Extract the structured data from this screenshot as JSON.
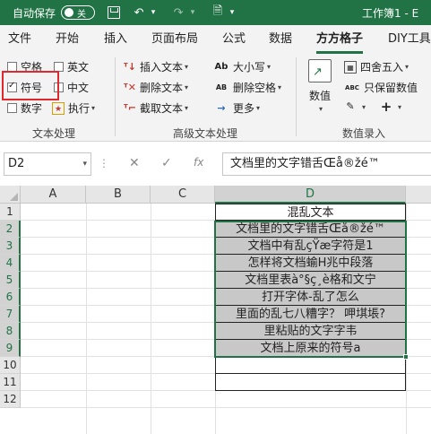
{
  "titlebar": {
    "autosave_label": "自动保存",
    "autosave_state": "关",
    "title": "工作簿1 - E"
  },
  "tabs": [
    "文件",
    "开始",
    "插入",
    "页面布局",
    "公式",
    "数据",
    "方方格子",
    "DIY工具"
  ],
  "active_tab": "方方格子",
  "ribbon": {
    "text_processing": {
      "label": "文本处理",
      "checkboxes": [
        {
          "label": "空格",
          "checked": false
        },
        {
          "label": "英文",
          "checked": false
        },
        {
          "label": "符号",
          "checked": true
        },
        {
          "label": "中文",
          "checked": false
        },
        {
          "label": "数字",
          "checked": false
        }
      ],
      "execute_label": "执行"
    },
    "advanced": {
      "label": "高级文本处理",
      "insert_text": "插入文本",
      "delete_text": "删除文本",
      "extract_text": "截取文本",
      "case_label": "大小写",
      "delete_space": "删除空格",
      "more": "更多",
      "case_icon": "Ab",
      "delete_space_icon": "AB"
    },
    "numbers": {
      "label": "数值录入",
      "value_label": "数值",
      "round_label": "四舍五入",
      "keep_value_label": "只保留数值",
      "keep_value_icon": "ABC"
    }
  },
  "formula_bar": {
    "name_box": "D2",
    "fx_label": "fx",
    "formula": "文档里的文字错舌Œå®žé™"
  },
  "grid": {
    "columns": [
      "A",
      "B",
      "C",
      "D"
    ],
    "selected_column": "D",
    "rows": [
      "1",
      "2",
      "3",
      "4",
      "5",
      "6",
      "7",
      "8",
      "9",
      "10",
      "11",
      "12"
    ],
    "d_cells": [
      "混乱文本",
      "文档里的文字错舌Œå®žé™",
      "文档中有乱çŸæ字符是1",
      "怎样将文档蝓H兆中段落",
      "文档里表à°§ç¸è格和文宁",
      "打开字体-乱了怎么",
      "里面的乱七八糟字？  呷㙋㙊?",
      "里粘贴的文字字韦",
      "文档上原来的符号a",
      "",
      ""
    ]
  }
}
